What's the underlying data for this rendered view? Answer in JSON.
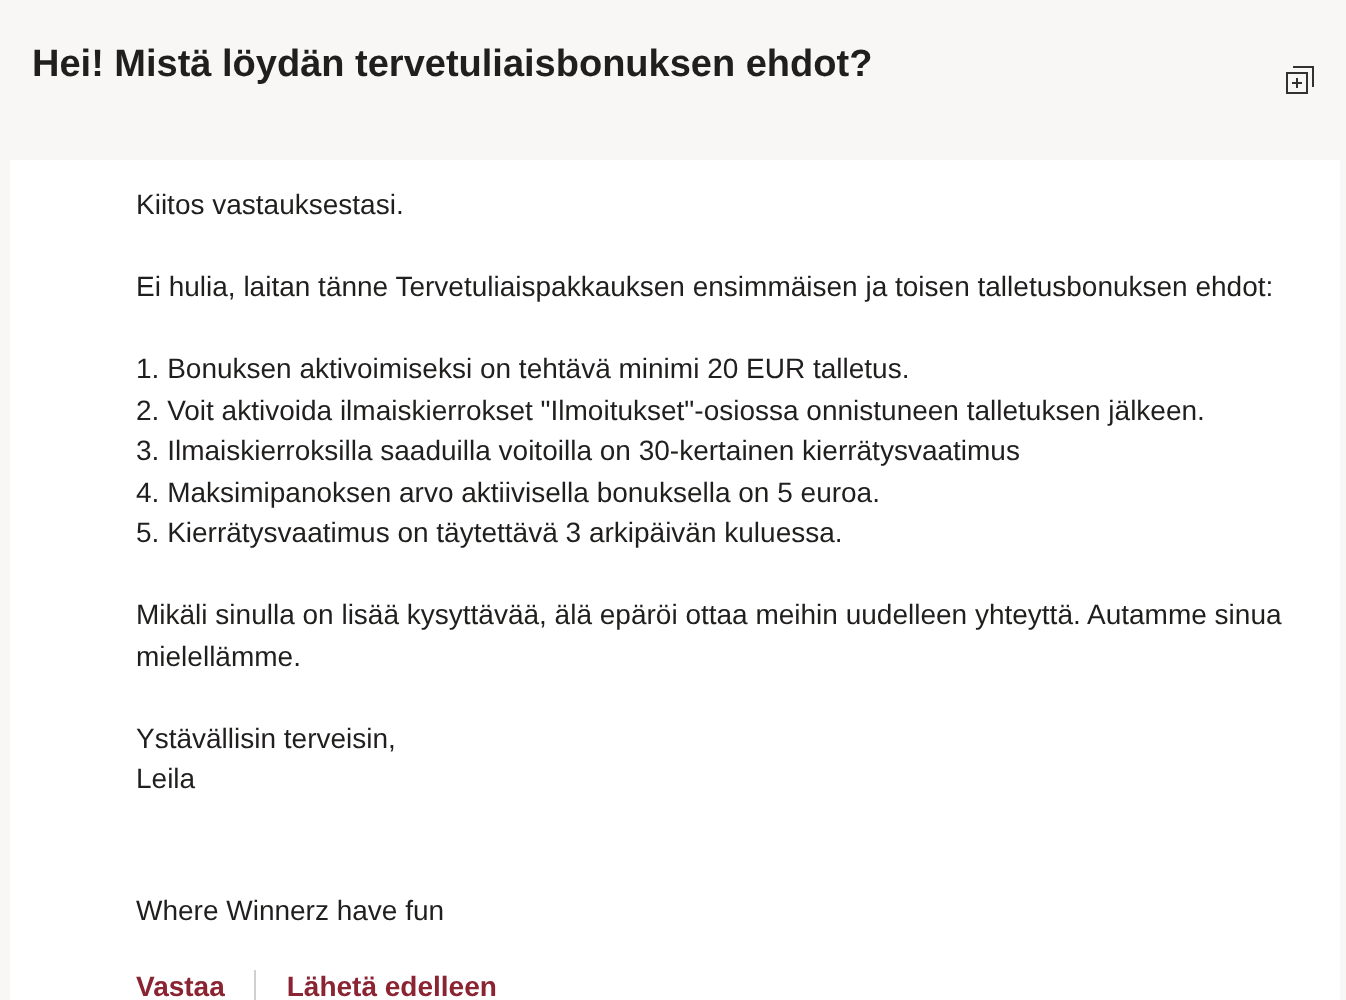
{
  "header": {
    "title": "Hei! Mistä löydän tervetuliaisbonuksen ehdot?"
  },
  "message": {
    "blocks": [
      {
        "kind": "paragraph",
        "lines": [
          "Kiitos vastauksestasi."
        ]
      },
      {
        "kind": "paragraph",
        "lines": [
          "Ei hulia, laitan tänne Tervetuliaispakkauksen ensimmäisen ja toisen talletusbonuksen ehdot:"
        ]
      },
      {
        "kind": "list",
        "lines": [
          "1. Bonuksen aktivoimiseksi on tehtävä minimi 20 EUR talletus.",
          "2. Voit aktivoida ilmaiskierrokset \"Ilmoitukset\"-osiossa onnistuneen talletuksen jälkeen.",
          "3. Ilmaiskierroksilla saaduilla voitoilla on 30-kertainen kierrätysvaatimus",
          "4. Maksimipanoksen arvo aktiivisella bonuksella on 5 euroa.",
          "5. Kierrätysvaatimus on täytettävä 3 arkipäivän kuluessa."
        ]
      },
      {
        "kind": "paragraph",
        "lines": [
          "Mikäli sinulla on lisää kysyttävää, älä epäröi ottaa meihin uudelleen yhteyttä. Autamme sinua mielellämme."
        ]
      },
      {
        "kind": "signature",
        "lines": [
          "Ystävällisin terveisin,",
          "Leila"
        ]
      },
      {
        "kind": "footer",
        "lines": [
          "Where Winnerz have fun"
        ]
      }
    ]
  },
  "actions": [
    "Vastaa",
    "Lähetä edelleen"
  ]
}
